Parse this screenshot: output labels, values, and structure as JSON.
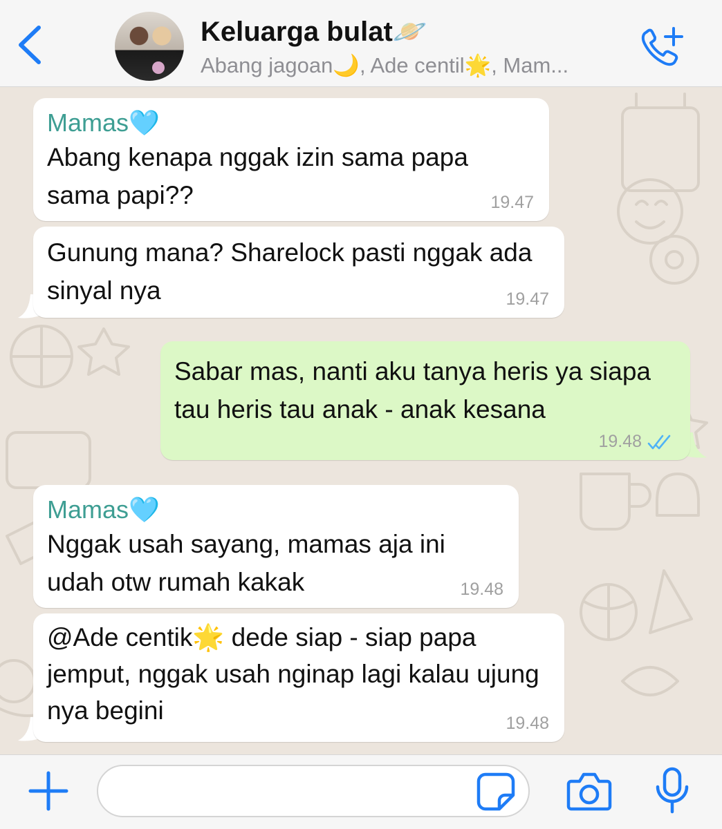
{
  "header": {
    "back_label": "Back",
    "title": "Keluarga bulat",
    "title_emoji": "🪐",
    "subtitle": "Abang jagoan🌙, Ade centil🌟, Mam...",
    "call_icon": "add-call-icon"
  },
  "messages": [
    {
      "direction": "in",
      "sender": "Mamas🩵",
      "text": "Abang kenapa nggak izin sama papa sama papi??",
      "time": "19.47"
    },
    {
      "direction": "in",
      "sender": "",
      "text": "Gunung mana? Sharelock pasti nggak ada sinyal nya",
      "time": "19.47"
    },
    {
      "direction": "out",
      "sender": "",
      "text": "Sabar mas, nanti aku tanya heris ya siapa tau heris tau anak - anak kesana",
      "time": "19.48",
      "status": "read"
    },
    {
      "direction": "in",
      "sender": "Mamas🩵",
      "text": "Nggak usah sayang, mamas aja ini udah otw rumah kakak",
      "time": "19.48"
    },
    {
      "direction": "in",
      "sender": "",
      "text": "@Ade centik🌟 dede siap - siap papa jemput, nggak usah nginap lagi kalau ujung nya begini",
      "time": "19.48"
    }
  ],
  "input": {
    "value": "",
    "placeholder": ""
  },
  "colors": {
    "accent": "#1e7cf6",
    "sender": "#3e9e93",
    "outgoing": "#dcf8c6",
    "incoming": "#ffffff",
    "wallpaper": "#ece5dd",
    "read_ticks": "#4fb3f6"
  }
}
